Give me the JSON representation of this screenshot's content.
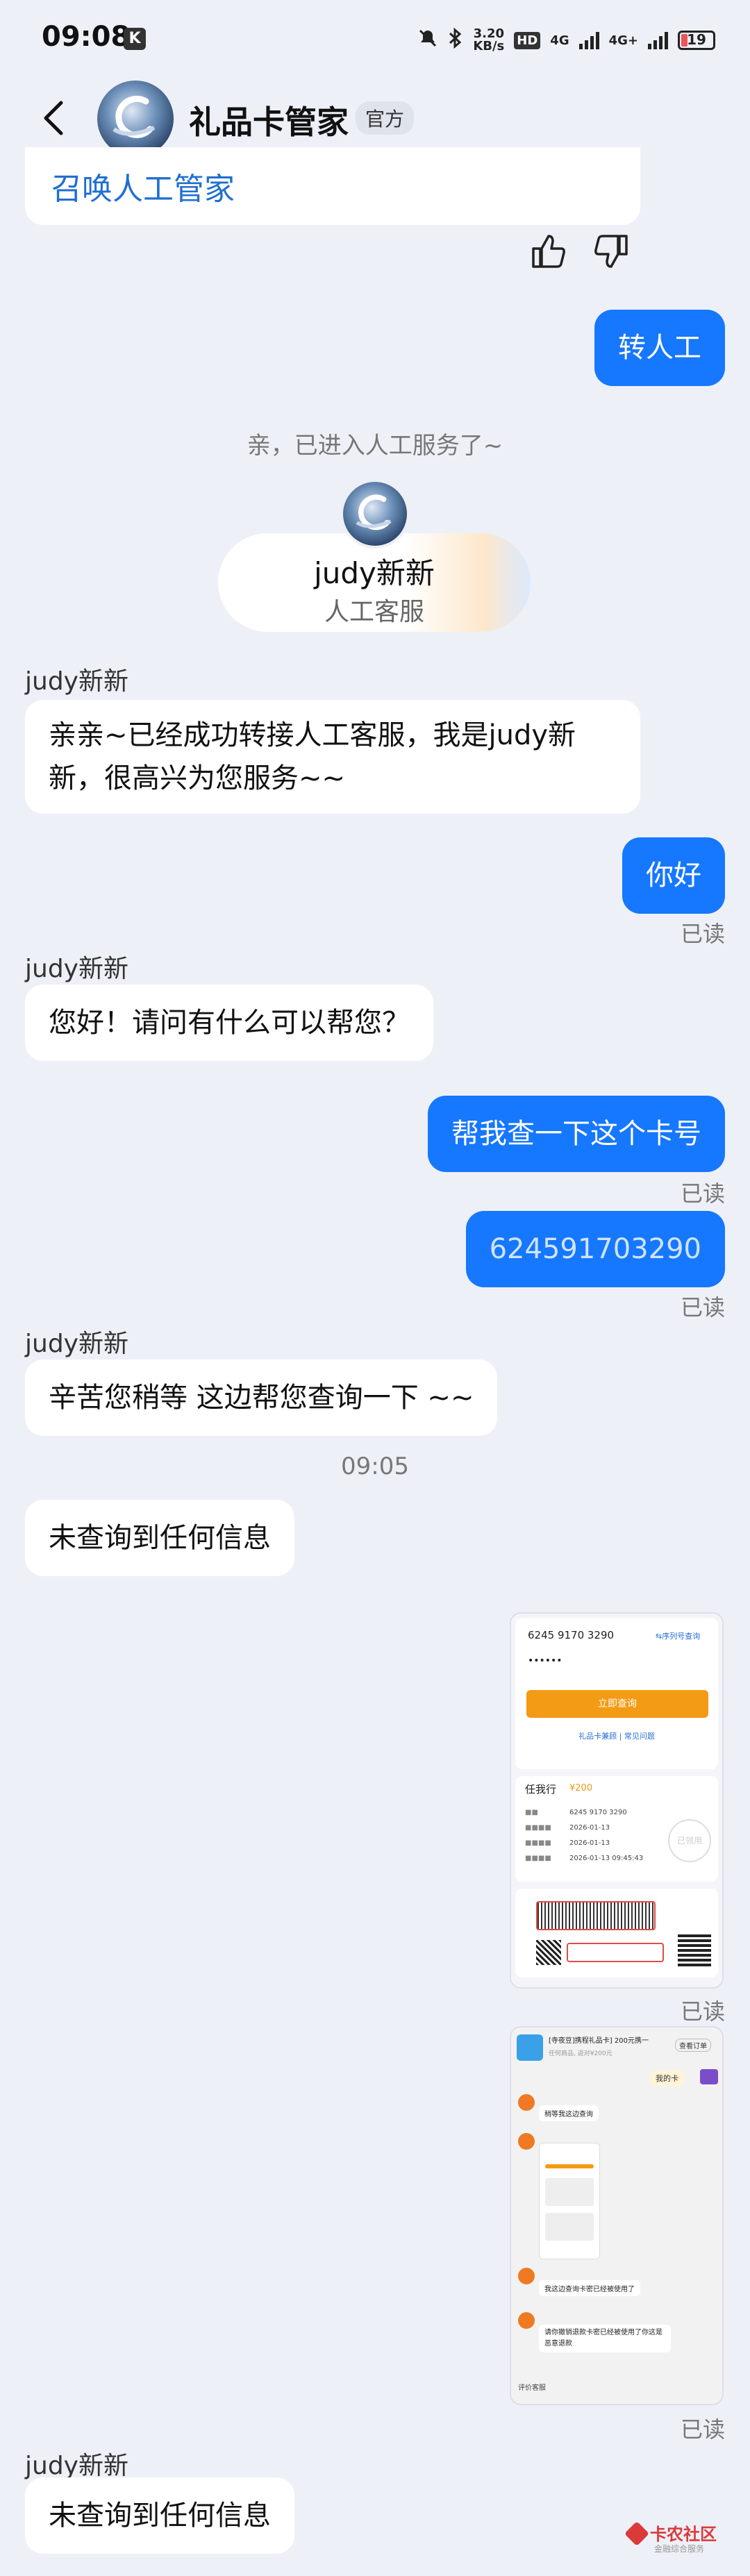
{
  "status_bar": {
    "time": "09:08",
    "k_badge": "K",
    "net_speed_value": "3.20",
    "net_speed_unit": "KB/s",
    "hd_badge": "HD",
    "sim1": "4G",
    "sim2": "4G+",
    "battery": "19"
  },
  "header": {
    "title": "礼品卡管家",
    "badge": "官方"
  },
  "messages": {
    "summon_link": "召唤人工管家",
    "out_transfer": "转人工",
    "sys_entered": "亲，已进入人工服务了~",
    "agent_card_name": "judy新新",
    "agent_card_role": "人工客服",
    "sender1": "judy新新",
    "in1": "亲亲~已经成功转接人工客服，我是judy新\n新，很高兴为您服务~~",
    "out_hello": "你好",
    "read1": "已读",
    "sender2": "judy新新",
    "in2": "您好！请问有什么可以帮您？",
    "out_query": "帮我查一下这个卡号",
    "read2": "已读",
    "out_card": "624591703290",
    "read3": "已读",
    "sender3": "judy新新",
    "in3": "辛苦您稍等 这边帮您查询一下 ~~",
    "time_sep": "09:05",
    "in4": "未查询到任何信息",
    "read4": "已读",
    "read5": "已读",
    "sender4": "judy新新",
    "in5": "未查询到任何信息"
  },
  "screenshot1": {
    "card_no": "6245 9170 3290",
    "link_right": "⇆序列号查询",
    "pwd": "••••••",
    "btn": "立即查询",
    "links": "礼品卡兼顾  |  常见问题",
    "name": "任我行",
    "price": "¥200",
    "row1": "6245 9170 3290",
    "row2": "2026-01-13",
    "row3": "2026-01-13",
    "row4": "2026-01-13 09:45:43",
    "stamp": "已领用"
  },
  "screenshot2": {
    "title": "[寺夜豆]携程礼品卡] 200元携一",
    "sub": "任何商品, 返对¥200元",
    "order_btn": "查看订单",
    "my_card": "我的卡",
    "m1": "稍等我这边查询",
    "m2": "我这边查询卡密已经被使用了",
    "m3": "请你撤销退款卡密已经被使用了你这是恶意退款",
    "footer": "评价客服"
  },
  "watermark": {
    "main": "卡农社区",
    "sub": "金融综合服务"
  },
  "colors": {
    "accent": "#1677ff",
    "background": "#eef0f7",
    "link": "#1f6fd1"
  },
  "icons": [
    "back-arrow-icon",
    "thumbs-up-icon",
    "thumbs-down-icon",
    "mute-icon",
    "bluetooth-icon"
  ]
}
